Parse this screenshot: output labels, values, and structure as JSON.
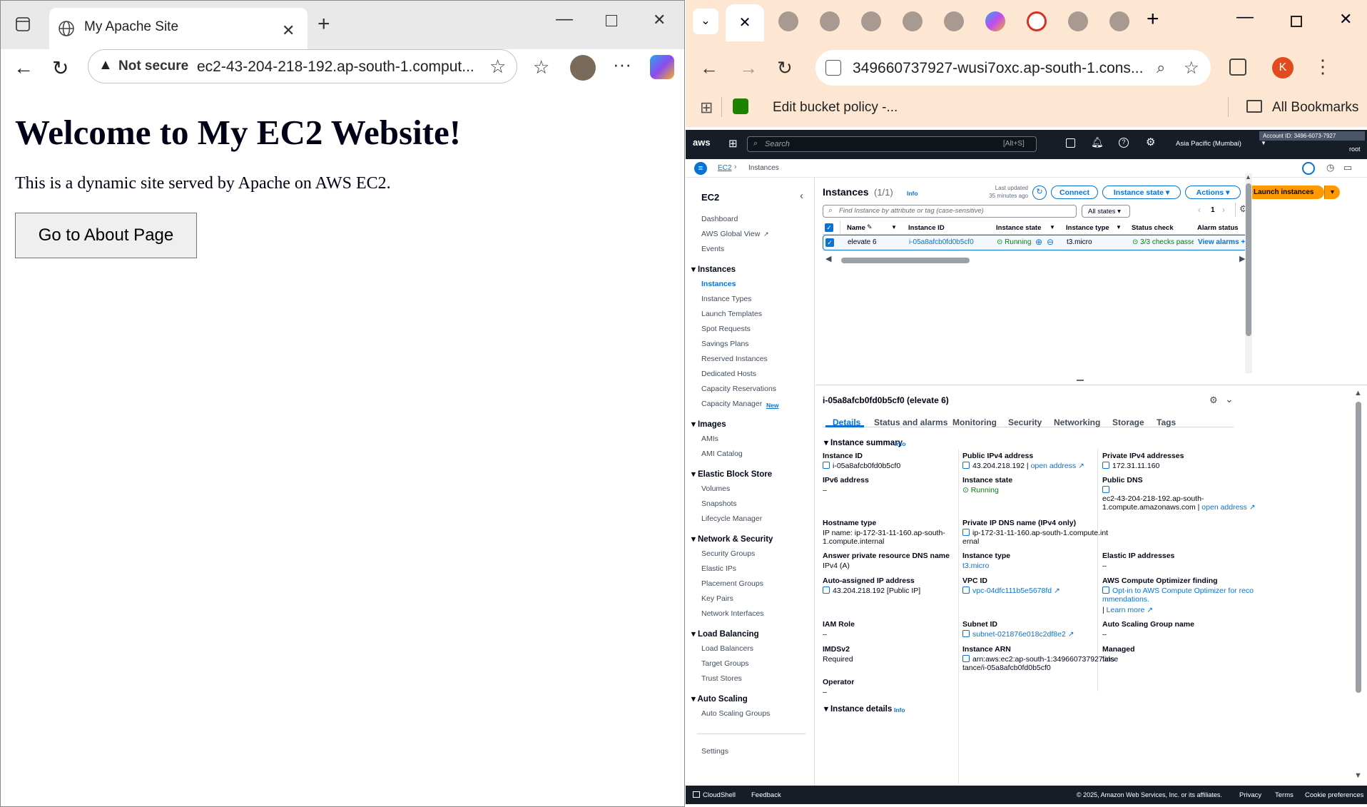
{
  "left": {
    "tab_title": "My Apache Site",
    "not_secure": "Not secure",
    "url": "ec2-43-204-218-192.ap-south-1.comput...",
    "heading": "Welcome to My EC2 Website!",
    "paragraph": "This is a dynamic site served by Apache on AWS EC2.",
    "button": "Go to About Page"
  },
  "right": {
    "url": "349660737927-wusi7oxc.ap-south-1.cons...",
    "bookmark": "Edit bucket policy -...",
    "all_bookmarks": "All Bookmarks",
    "profile_letter": "K",
    "search_placeholder": "Search",
    "search_shortcut": "[Alt+S]",
    "region": "Asia Pacific (Mumbai)",
    "account_id": "Account ID: 3496-6073-7927",
    "user": "root",
    "breadcrumb": {
      "ec2": "EC2",
      "instances": "Instances"
    },
    "sidebar": {
      "title": "EC2",
      "items_top": [
        "Dashboard",
        "AWS Global View",
        "Events"
      ],
      "groups": [
        {
          "title": "Instances",
          "items": [
            "Instances",
            "Instance Types",
            "Launch Templates",
            "Spot Requests",
            "Savings Plans",
            "Reserved Instances",
            "Dedicated Hosts",
            "Capacity Reservations",
            "Capacity Manager"
          ]
        },
        {
          "title": "Images",
          "items": [
            "AMIs",
            "AMI Catalog"
          ]
        },
        {
          "title": "Elastic Block Store",
          "items": [
            "Volumes",
            "Snapshots",
            "Lifecycle Manager"
          ]
        },
        {
          "title": "Network & Security",
          "items": [
            "Security Groups",
            "Elastic IPs",
            "Placement Groups",
            "Key Pairs",
            "Network Interfaces"
          ]
        },
        {
          "title": "Load Balancing",
          "items": [
            "Load Balancers",
            "Target Groups",
            "Trust Stores"
          ]
        },
        {
          "title": "Auto Scaling",
          "items": [
            "Auto Scaling Groups"
          ]
        }
      ],
      "new_badge": "New",
      "settings": "Settings"
    },
    "instances": {
      "title": "Instances",
      "count": "(1/1)",
      "info": "Info",
      "last_updated": "Last updated",
      "updated_ago": "35 minutes ago",
      "connect": "Connect",
      "instance_state": "Instance state",
      "actions": "Actions",
      "launch": "Launch instances",
      "filter_placeholder": "Find Instance by attribute or tag (case-sensitive)",
      "all_states": "All states",
      "page": "1",
      "columns": [
        "Name",
        "Instance ID",
        "Instance state",
        "Instance type",
        "Status check",
        "Alarm status"
      ],
      "row": {
        "name": "elevate 6",
        "id": "i-05a8afcb0fd0b5cf0",
        "state": "Running",
        "type": "t3.micro",
        "status": "3/3 checks passed",
        "alarm": "View alarms"
      }
    },
    "detail": {
      "title": "i-05a8afcb0fd0b5cf0 (elevate 6)",
      "tabs": [
        "Details",
        "Status and alarms",
        "Monitoring",
        "Security",
        "Networking",
        "Storage",
        "Tags"
      ],
      "summary": "Instance summary",
      "details_section": "Instance details",
      "f": {
        "instance_id_l": "Instance ID",
        "instance_id": "i-05a8afcb0fd0b5cf0",
        "public_ipv4_l": "Public IPv4 address",
        "public_ipv4": "43.204.218.192",
        "open_address": "open address",
        "private_ipv4_l": "Private IPv4 addresses",
        "private_ipv4": "172.31.11.160",
        "ipv6_l": "IPv6 address",
        "dash": "–",
        "state_l": "Instance state",
        "state": "Running",
        "public_dns_l": "Public DNS",
        "public_dns_1": "ec2-43-204-218-192.ap-south-",
        "public_dns_2": "1.compute.amazonaws.com |",
        "hostname_l": "Hostname type",
        "hostname_1": "IP name: ip-172-31-11-160.ap-south-",
        "hostname_2": "1.compute.internal",
        "private_dns_l": "Private IP DNS name (IPv4 only)",
        "private_dns_1": "ip-172-31-11-160.ap-south-1.compute.int",
        "private_dns_2": "ernal",
        "answer_l": "Answer private resource DNS name",
        "answer": "IPv4 (A)",
        "type_l": "Instance type",
        "type": "t3.micro",
        "elastic_l": "Elastic IP addresses",
        "auto_ip_l": "Auto-assigned IP address",
        "auto_ip": "43.204.218.192 [Public IP]",
        "vpc_l": "VPC ID",
        "vpc": "vpc-04dfc111b5e5678fd",
        "optimizer_l": "AWS Compute Optimizer finding",
        "optimizer_1": "Opt-in to AWS Compute Optimizer for reco",
        "optimizer_2": "mmendations.",
        "learn_more": "Learn more",
        "iam_l": "IAM Role",
        "subnet_l": "Subnet ID",
        "subnet": "subnet-021876e018c2df8e2",
        "asg_l": "Auto Scaling Group name",
        "imds_l": "IMDSv2",
        "imds": "Required",
        "arn_l": "Instance ARN",
        "arn_1": "arn:aws:ec2:ap-south-1:349660737927:ins",
        "arn_2": "tance/i-05a8afcb0fd0b5cf0",
        "managed_l": "Managed",
        "managed": "false",
        "operator_l": "Operator"
      }
    },
    "footer": {
      "cloudshell": "CloudShell",
      "feedback": "Feedback",
      "copyright": "© 2025, Amazon Web Services, Inc. or its affiliates.",
      "privacy": "Privacy",
      "terms": "Terms",
      "cookies": "Cookie preferences"
    }
  }
}
